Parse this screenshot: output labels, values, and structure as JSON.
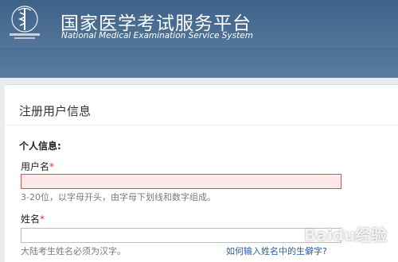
{
  "header": {
    "title_cn": "国家医学考试服务平台",
    "title_en": "National Medical Examination Service System",
    "logo_icon": "medical-caduceus-emblem-icon",
    "logo_text": "国家医学考试服务平台"
  },
  "form": {
    "title": "注册用户信息",
    "section_label": "个人信息:",
    "username": {
      "label": "用户名",
      "required_mark": "*",
      "value": "",
      "hint": "3-20位，以字母开头，由字母下划线和数字组成。"
    },
    "name": {
      "label": "姓名",
      "required_mark": "*",
      "value": "",
      "hint": "大陆考生姓名必须为汉字。",
      "help_link": "如何输入姓名中的生僻字?"
    }
  },
  "watermark": "Baidu经验",
  "colors": {
    "header_bg": "#3d6188",
    "required": "#e03030",
    "error_border": "#d9534f",
    "error_bg": "#fde8ea",
    "link": "#2a5d9f"
  }
}
